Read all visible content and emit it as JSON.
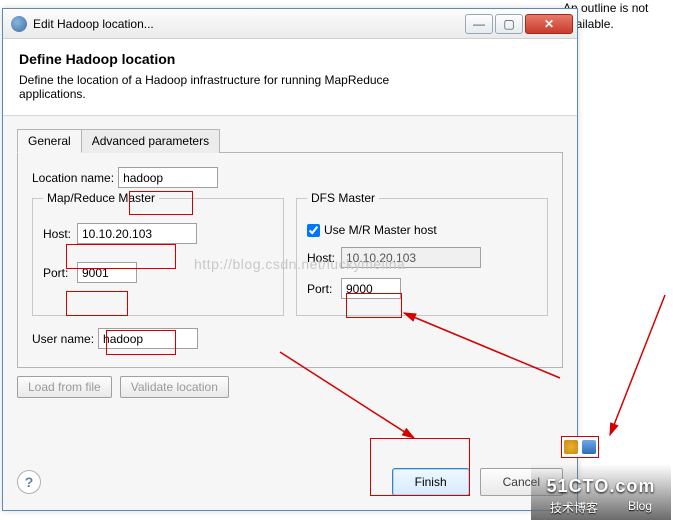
{
  "outline_text": "An outline is not available.",
  "dialog": {
    "title": "Edit Hadoop location...",
    "header_title": "Define Hadoop location",
    "header_desc": "Define the location of a Hadoop infrastructure for running MapReduce applications."
  },
  "tabs": {
    "general": "General",
    "advanced": "Advanced parameters"
  },
  "fields": {
    "location_label": "Location name:",
    "location_value": "hadoop",
    "mr_title": "Map/Reduce Master",
    "host_label": "Host:",
    "mr_host": "10.10.20.103",
    "port_label": "Port:",
    "mr_port": "9001",
    "dfs_title": "DFS Master",
    "use_mr_label": "Use M/R Master host",
    "use_mr_checked": true,
    "dfs_host": "10.10.20.103",
    "dfs_port": "9000",
    "user_label": "User name:",
    "user_value": "hadoop"
  },
  "buttons": {
    "load": "Load from file",
    "validate": "Validate location",
    "finish": "Finish",
    "cancel": "Cancel"
  },
  "watermark": "http://blog.csdn.net/luckymelina",
  "logo": {
    "brand": "51CTO.com",
    "sub1": "技术博客",
    "sub2": "Blog"
  }
}
